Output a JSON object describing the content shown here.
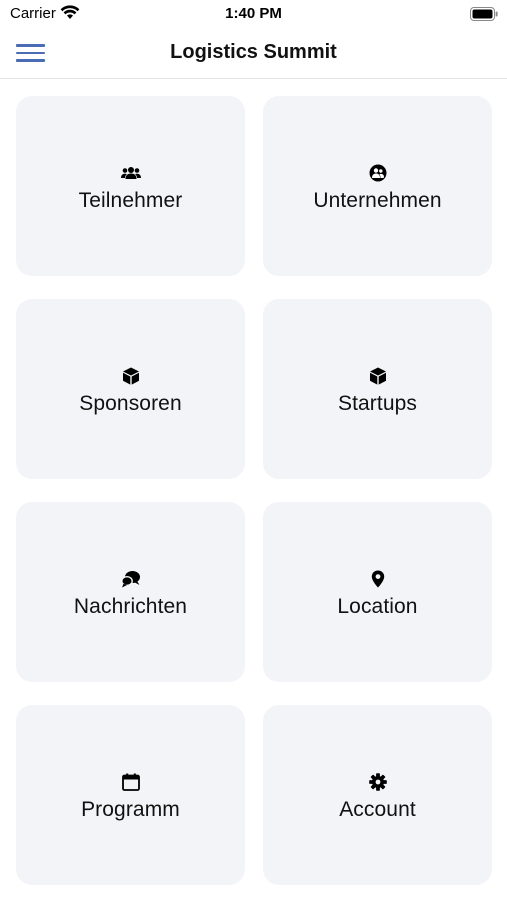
{
  "status_bar": {
    "carrier": "Carrier",
    "time": "1:40 PM"
  },
  "nav": {
    "title": "Logistics Summit",
    "menu_icon": "hamburger-menu-icon"
  },
  "colors": {
    "accent": "#4a6bb5",
    "tile_background": "#f3f4f7"
  },
  "tiles": [
    {
      "label": "Teilnehmer",
      "icon": "users-icon"
    },
    {
      "label": "Unternehmen",
      "icon": "company-users-icon"
    },
    {
      "label": "Sponsoren",
      "icon": "cube-icon"
    },
    {
      "label": "Startups",
      "icon": "cube-icon"
    },
    {
      "label": "Nachrichten",
      "icon": "chat-bubbles-icon"
    },
    {
      "label": "Location",
      "icon": "map-pin-icon"
    },
    {
      "label": "Programm",
      "icon": "calendar-icon"
    },
    {
      "label": "Account",
      "icon": "gear-icon"
    }
  ]
}
